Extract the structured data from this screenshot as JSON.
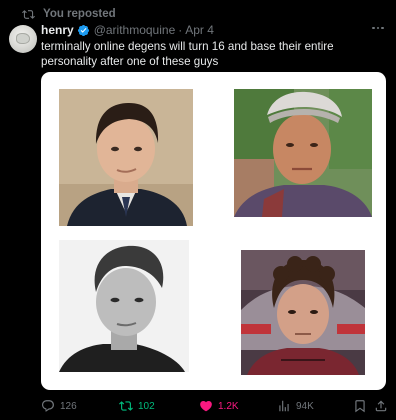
{
  "repost": {
    "label": "You reposted",
    "icon": "repost-icon"
  },
  "tweet": {
    "author_name": "henry",
    "verified_icon": "verified-badge-icon",
    "handle": "@arithmoquine",
    "separator": "·",
    "time": "Apr 4",
    "more_icon": "more-options-icon",
    "text": "terminally online degens will turn 16 and base their entire personality after one of these guys"
  },
  "media": {
    "photos": [
      {
        "name": "photo-1",
        "desc_icon": "portrait-photo"
      },
      {
        "name": "photo-2",
        "desc_icon": "portrait-photo"
      },
      {
        "name": "photo-3",
        "desc_icon": "portrait-photo"
      },
      {
        "name": "photo-4",
        "desc_icon": "portrait-photo"
      }
    ]
  },
  "actions": {
    "reply_count": "126",
    "repost_count": "102",
    "like_count": "1.2K",
    "views_count": "94K"
  },
  "colors": {
    "background": "#000000",
    "text": "#e7e9ea",
    "secondary": "#71767b",
    "verified": "#1d9bf0",
    "repost_active": "#00ba7c",
    "like_active": "#f91880"
  }
}
